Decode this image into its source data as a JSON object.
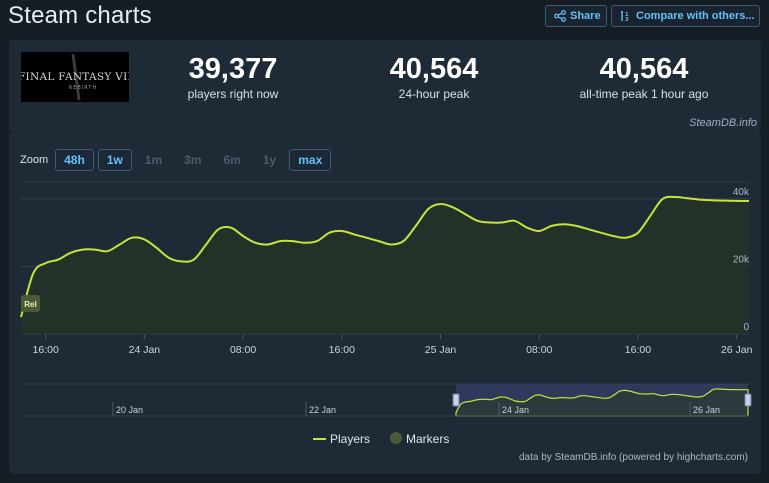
{
  "header": {
    "title": "Steam charts",
    "share_label": "Share",
    "compare_label": "Compare with others..."
  },
  "game": {
    "logo_text": "FINAL FANTASY VII",
    "logo_subtext": "REBIRTH"
  },
  "stats": [
    {
      "value": "39,377",
      "label": "players right now"
    },
    {
      "value": "40,564",
      "label": "24-hour peak"
    },
    {
      "value": "40,564",
      "label": "all-time peak 1 hour ago"
    }
  ],
  "credit": "SteamDB.info",
  "zoom": {
    "label": "Zoom",
    "options": [
      {
        "label": "48h",
        "active": true
      },
      {
        "label": "1w",
        "active": true
      },
      {
        "label": "1m",
        "active": false
      },
      {
        "label": "3m",
        "active": false
      },
      {
        "label": "6m",
        "active": false
      },
      {
        "label": "1y",
        "active": false
      },
      {
        "label": "max",
        "active": true
      }
    ]
  },
  "legend": {
    "players": "Players",
    "markers": "Markers"
  },
  "data_credit": "data by SteamDB.info (powered by highcharts.com)",
  "colors": {
    "line": "#c5e53a",
    "area": "#253426",
    "marker": "#4e5a36",
    "accent": "#66c0f4",
    "navigator_window": "#3b4473"
  },
  "chart_data": {
    "type": "area",
    "title": "",
    "series": [
      {
        "name": "Players",
        "x": [
          0,
          1,
          2,
          3,
          4,
          5,
          6,
          7,
          8,
          9,
          10,
          11,
          12,
          13,
          14,
          15,
          16,
          17,
          18,
          19,
          20,
          21,
          22,
          23,
          24,
          25,
          26,
          27,
          28,
          29,
          30,
          31,
          32,
          33,
          34,
          35,
          36,
          37,
          38,
          39,
          40,
          41,
          42,
          43,
          44,
          45,
          46,
          47,
          48,
          49,
          50,
          51,
          52,
          53,
          54,
          55,
          56,
          57,
          58,
          59
        ],
        "values": [
          5000,
          18000,
          21000,
          22000,
          24000,
          25000,
          25000,
          24500,
          26500,
          28500,
          28000,
          25500,
          22500,
          21500,
          22000,
          26500,
          31000,
          31500,
          29000,
          27000,
          26500,
          27500,
          27500,
          27000,
          27500,
          30000,
          30500,
          29500,
          28500,
          27500,
          26500,
          27500,
          32000,
          37000,
          38500,
          37500,
          35500,
          33500,
          33000,
          33000,
          33500,
          31500,
          30500,
          32000,
          32500,
          32000,
          31000,
          30000,
          29000,
          28500,
          30000,
          35000,
          40000,
          40564,
          40200,
          39800,
          39600,
          39500,
          39400,
          39377
        ]
      }
    ],
    "ylim": [
      0,
      45000
    ],
    "yticks": [
      {
        "value": 0,
        "label": "0"
      },
      {
        "value": 20000,
        "label": "20k"
      },
      {
        "value": 40000,
        "label": "40k"
      }
    ],
    "xticks": [
      {
        "x": 2,
        "label": "16:00"
      },
      {
        "x": 10,
        "label": "24 Jan"
      },
      {
        "x": 18,
        "label": "08:00"
      },
      {
        "x": 26,
        "label": "16:00"
      },
      {
        "x": 34,
        "label": "25 Jan"
      },
      {
        "x": 42,
        "label": "08:00"
      },
      {
        "x": 50,
        "label": "16:00"
      },
      {
        "x": 58,
        "label": "26 Jan"
      }
    ],
    "marker": {
      "label": "Rel"
    },
    "navigator": {
      "labels": [
        "20 Jan",
        "22 Jan",
        "24 Jan",
        "26 Jan"
      ]
    },
    "grid": true
  }
}
